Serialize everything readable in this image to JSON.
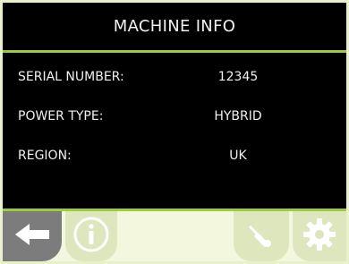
{
  "header": {
    "title": "MACHINE INFO"
  },
  "info": {
    "rows": [
      {
        "label": "SERIAL NUMBER:",
        "value": "12345"
      },
      {
        "label": "POWER TYPE:",
        "value": "HYBRID"
      },
      {
        "label": "REGION:",
        "value": "UK"
      }
    ]
  },
  "footer": {
    "buttons": [
      {
        "icon": "back-arrow-icon"
      },
      {
        "icon": "info-icon"
      },
      {
        "icon": "wrench-icon"
      },
      {
        "icon": "gear-icon"
      }
    ]
  },
  "colors": {
    "header_bg": "#000000",
    "accent": "#9ccc3a",
    "footer_bg": "#f2f7dd",
    "back_button": "#7c7c7c"
  }
}
